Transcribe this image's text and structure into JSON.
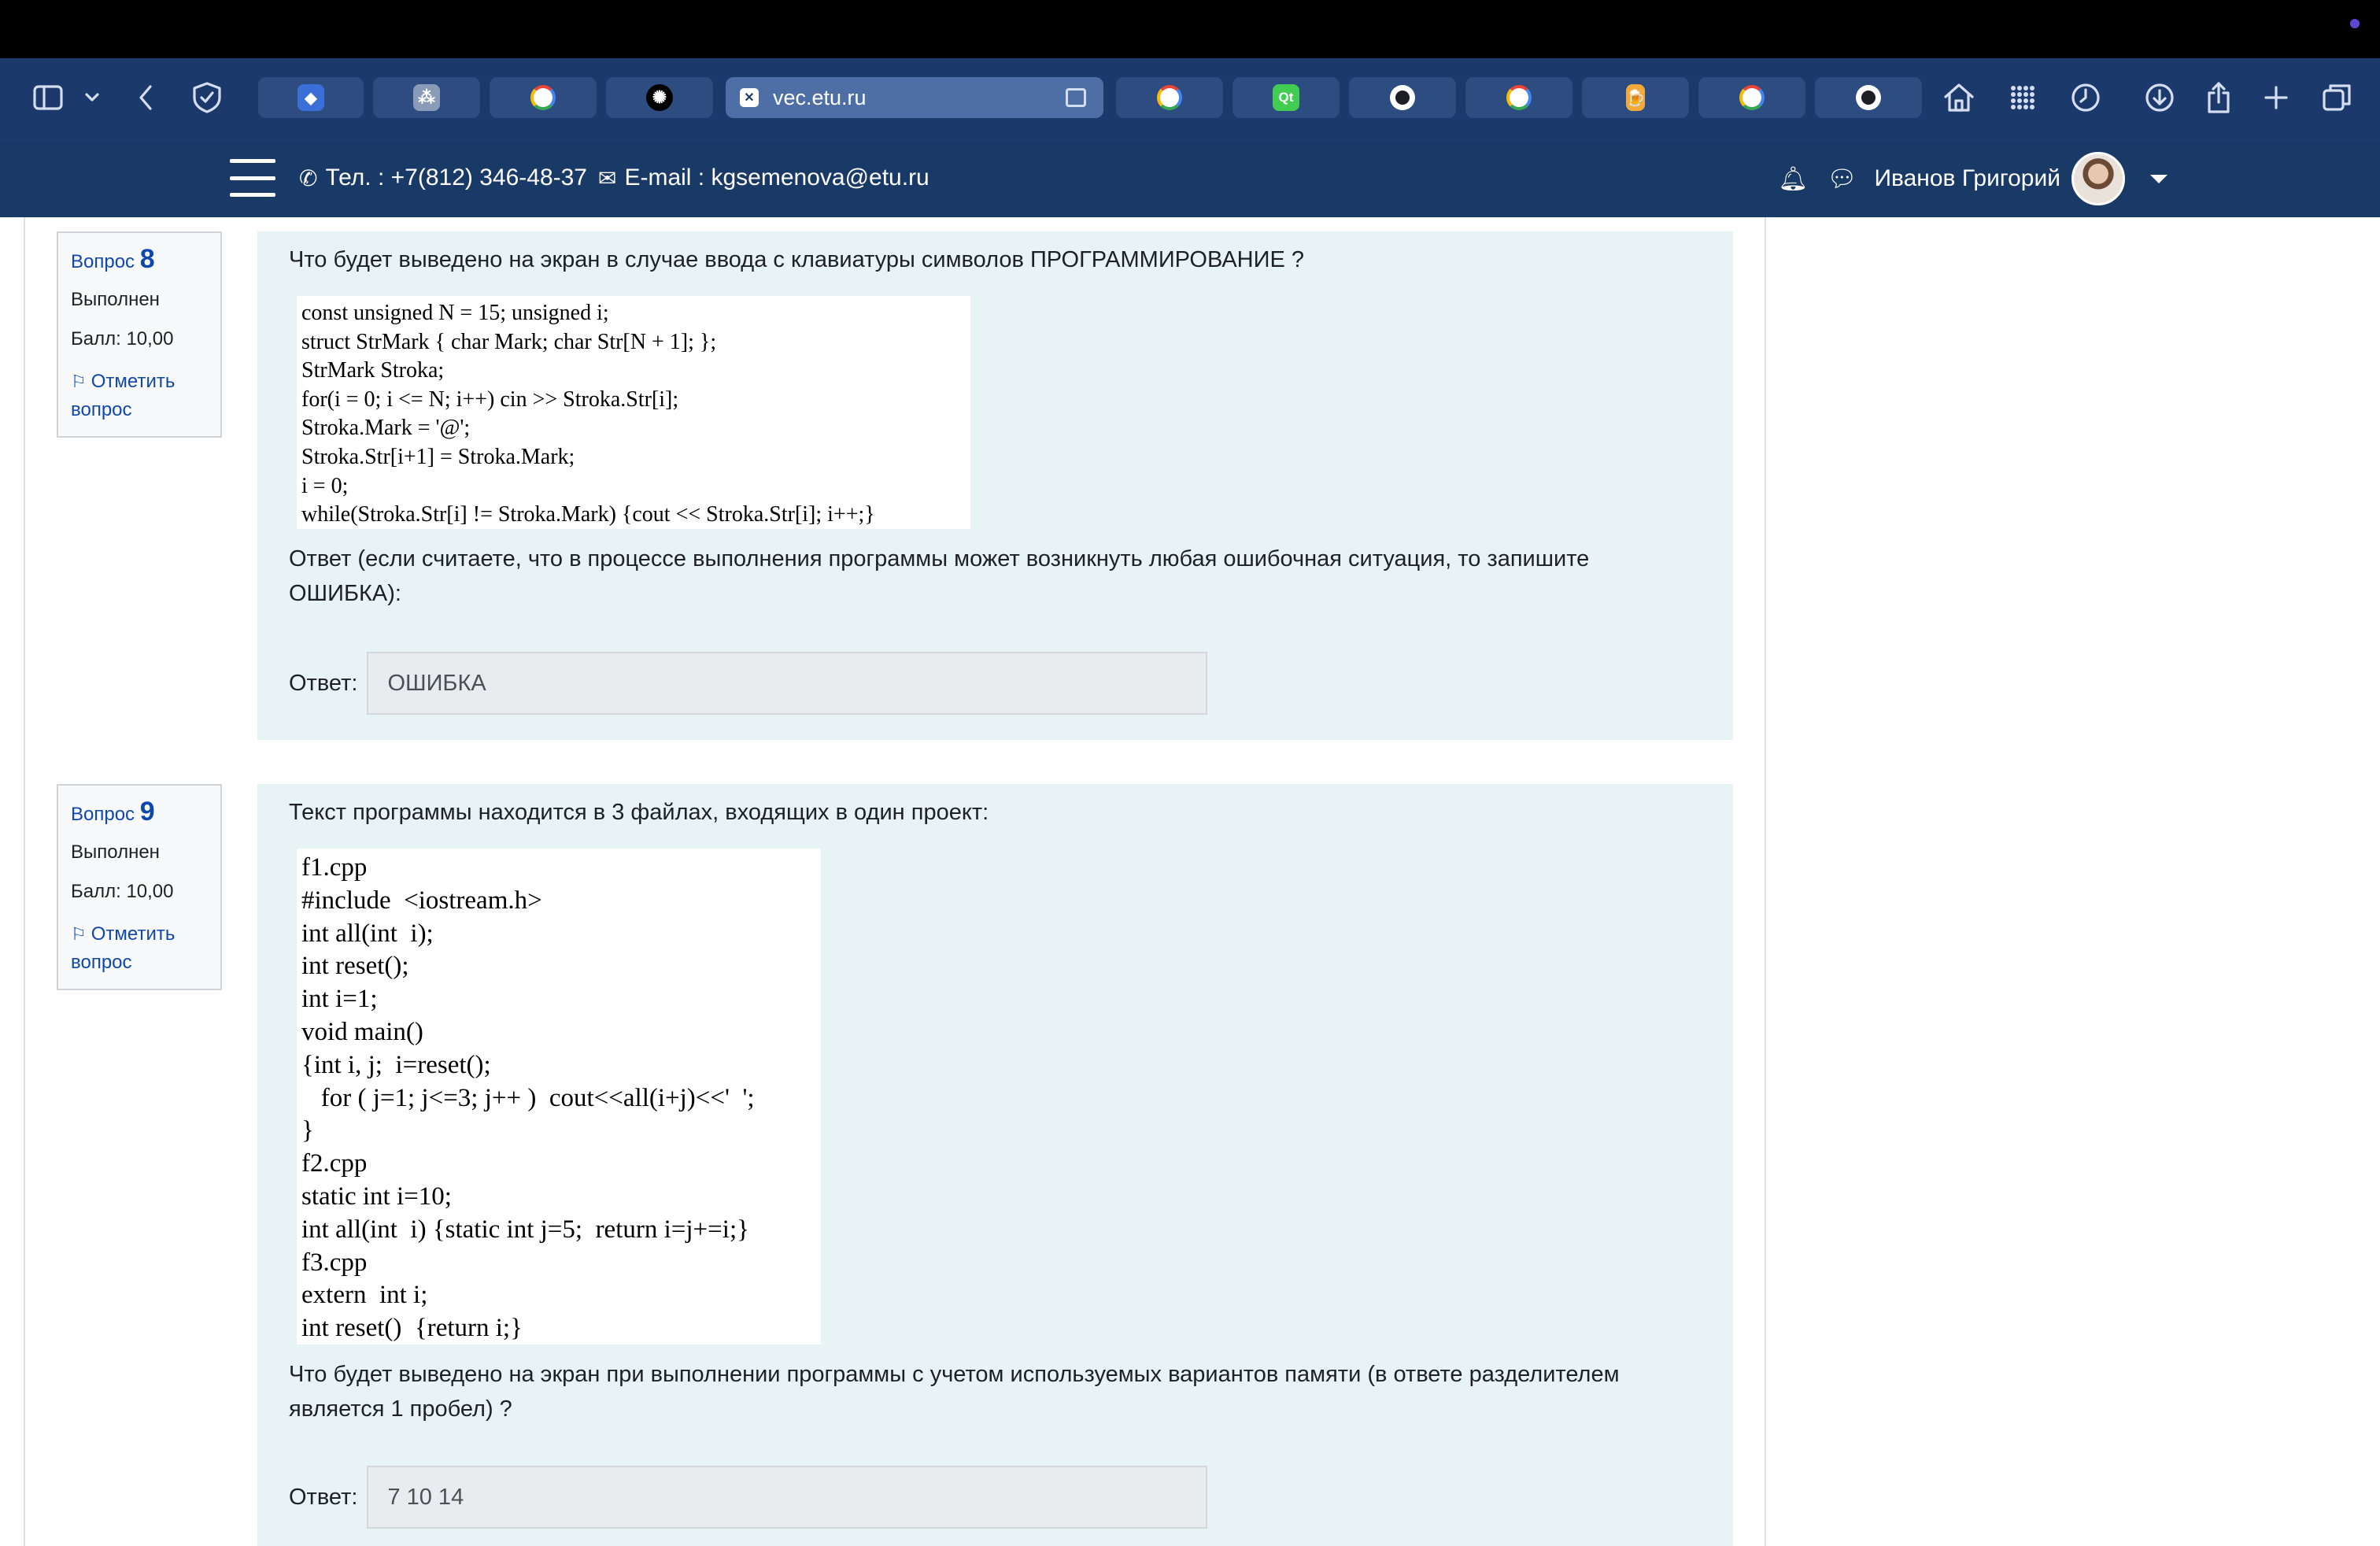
{
  "browser": {
    "active_tab_url": "vec.etu.ru",
    "tabs": [
      {
        "icon": "bitwarden-icon"
      },
      {
        "icon": "app-grid-icon"
      },
      {
        "icon": "google-icon"
      },
      {
        "icon": "chatgpt-icon"
      },
      {
        "icon": "page-x-icon",
        "title": "vec.etu.ru",
        "active": true
      },
      {
        "icon": "google-icon"
      },
      {
        "icon": "qt-icon",
        "fav_text": "Qt"
      },
      {
        "icon": "github-icon"
      },
      {
        "icon": "google-icon"
      },
      {
        "icon": "beer-icon"
      },
      {
        "icon": "google-icon"
      },
      {
        "icon": "github-icon"
      }
    ]
  },
  "navbar": {
    "phone": "Тел. : +7(812) 346-48-37",
    "email": "E-mail : kgsemenova@etu.ru",
    "user_name": "Иванов Григорий"
  },
  "questions": [
    {
      "label": "Вопрос",
      "number": "8",
      "state": "Выполнен",
      "grade": "Балл: 10,00",
      "flag_line1": "Отметить",
      "flag_line2": "вопрос",
      "text": "Что будет выведено на экран в случае ввода с клавиатуры символов ПРОГРАММИРОВАНИЕ ?",
      "code": [
        "const unsigned N = 15; unsigned i;",
        "struct StrMark { char Mark; char Str[N + 1]; };",
        "StrMark Stroka;",
        "for(i = 0; i <= N; i++) cin >> Stroka.Str[i];",
        "Stroka.Mark = '@';",
        "Stroka.Str[i+1] = Stroka.Mark;",
        "i = 0;",
        "while(Stroka.Str[i] != Stroka.Mark) {cout << Stroka.Str[i]; i++;}"
      ],
      "prompt_line1": "Ответ (если считаете, что в процессе выполнения программы может возникнуть любая ошибочная ситуация, то запишите",
      "prompt_line2": "ОШИБКА):",
      "answer_label": "Ответ:",
      "answer_value": "ОШИБКА"
    },
    {
      "label": "Вопрос",
      "number": "9",
      "state": "Выполнен",
      "grade": "Балл: 10,00",
      "flag_line1": "Отметить",
      "flag_line2": "вопрос",
      "text": "Текст программы находится в 3 файлах, входящих в один проект:",
      "code": [
        "f1.cpp",
        "#include  <iostream.h>",
        "int all(int  i);",
        "int reset();",
        "int i=1;",
        "void main()",
        "{int i, j;  i=reset();",
        "   for ( j=1; j<=3; j++ )  cout<<all(i+j)<<'  ';",
        "}",
        "f2.cpp",
        "static int i=10;",
        "int all(int  i) {static int j=5;  return i=j+=i;}",
        "f3.cpp",
        "extern  int i;",
        "int reset()  {return i;}"
      ],
      "prompt_line1": "Что будет выведено на экран при выполнении программы с учетом используемых вариантов памяти (в ответе разделителем",
      "prompt_line2": "является 1 пробел) ?",
      "answer_label": "Ответ:",
      "answer_value": "7 10 14"
    }
  ]
}
